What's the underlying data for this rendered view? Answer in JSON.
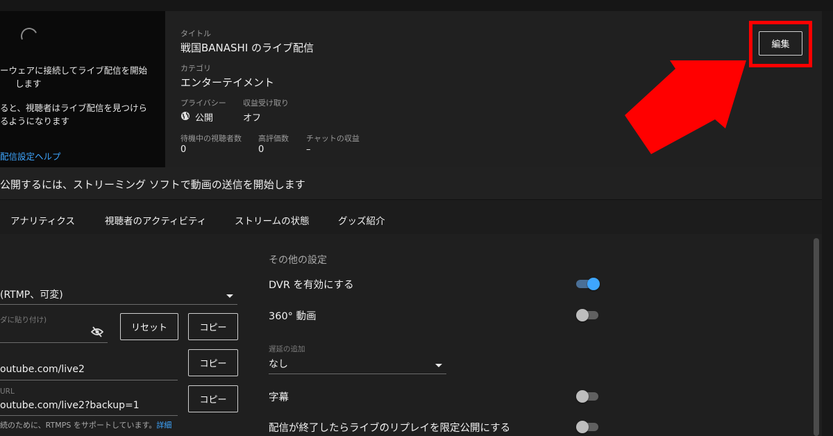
{
  "preview": {
    "line1": "ーウェアに接続してライブ配信を開始",
    "line2": "します",
    "line3": "ると、視聴者はライブ配信を見つけら",
    "line4": "るようになります",
    "help_link": "配信設定ヘルプ"
  },
  "stream_info": {
    "title_label": "タイトル",
    "title_value": "戦国BANASHI のライブ配信",
    "category_label": "カテゴリ",
    "category_value": "エンターテイメント",
    "privacy_label": "プライバシー",
    "privacy_value": "公開",
    "monetization_label": "収益受け取り",
    "monetization_value": "オフ",
    "waiting_viewers_label": "待機中の視聴者数",
    "waiting_viewers_value": "0",
    "likes_label": "高評価数",
    "likes_value": "0",
    "chat_revenue_label": "チャットの収益",
    "chat_revenue_value": "–",
    "edit_button": "編集"
  },
  "banner": {
    "text": "公開するには、ストリーミング ソフトで動画の送信を開始します"
  },
  "tabs": [
    {
      "label": "アナリティクス"
    },
    {
      "label": "視聴者のアクティビティ"
    },
    {
      "label": "ストリームの状態"
    },
    {
      "label": "グッズ紹介"
    }
  ],
  "stream_settings": {
    "stream_key_type": "(RTMP、可変)",
    "stream_key_label": "ダに貼り付け)",
    "reset_button": "リセット",
    "copy_button": "コピー",
    "server_url": "outube.com/live2",
    "backup_url_label": "URL",
    "backup_url": "outube.com/live2?backup=1",
    "note_text": "続のために、RTMPS をサポートしています。",
    "note_link": "詳細"
  },
  "other_settings": {
    "title": "その他の設定",
    "dvr_label": "DVR を有効にする",
    "dvr_on": true,
    "video360_label": "360° 動画",
    "video360_on": false,
    "latency_label": "遅延の追加",
    "latency_value": "なし",
    "captions_label": "字幕",
    "captions_on": false,
    "replay_label": "配信が終了したらライブのリプレイを限定公開にする",
    "replay_on": false
  },
  "colors": {
    "accent_blue": "#3ea6ff",
    "annotation_red": "#ff0000"
  }
}
